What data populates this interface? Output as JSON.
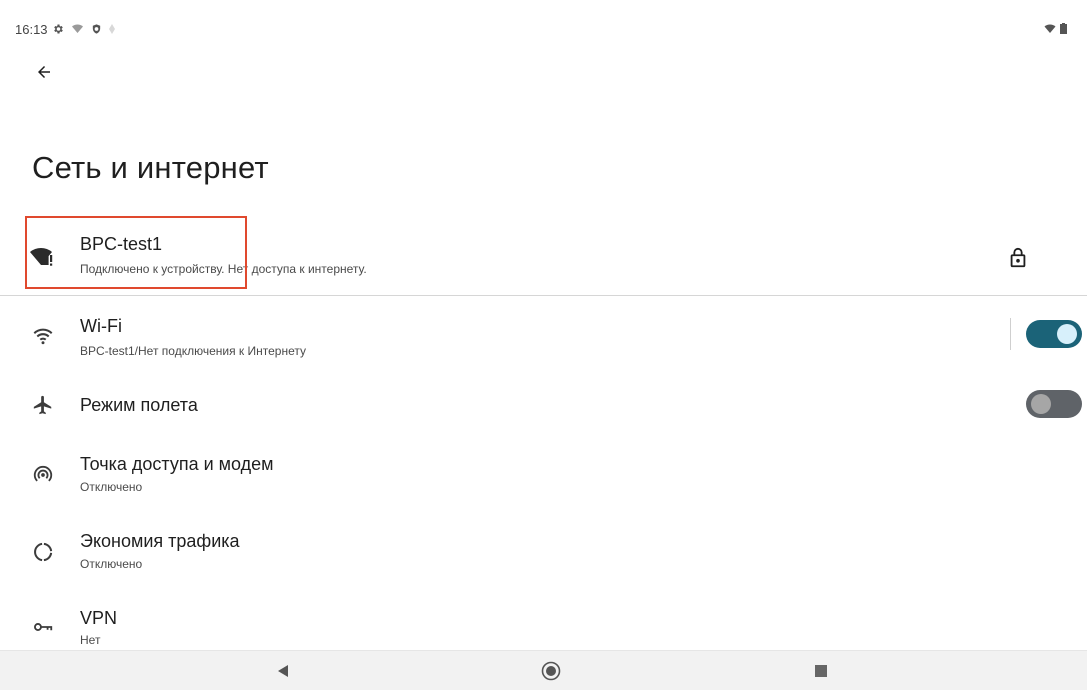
{
  "status_bar": {
    "time": "16:13",
    "icons": [
      "gear-icon",
      "wifi-question-icon",
      "shield-icon",
      "dot-icon"
    ],
    "right_icons": [
      "wifi-alert-icon",
      "battery-icon"
    ]
  },
  "header": {
    "back_icon": "arrow-back-icon",
    "title": "Сеть и интернет"
  },
  "network": {
    "name": "BPC-test1",
    "status": "Подключено к устройству. Нет доступа к интернету.",
    "icon": "wifi-alert-icon",
    "secure_icon": "lock-icon",
    "highlight_color": "#e0492e"
  },
  "settings": [
    {
      "icon": "wifi-icon",
      "title": "Wi-Fi",
      "subtitle": "BPC-test1/Нет подключения к Интернету",
      "toggle": true
    },
    {
      "icon": "airplane-icon",
      "title": "Режим полета",
      "subtitle": "",
      "toggle": false
    },
    {
      "icon": "hotspot-icon",
      "title": "Точка доступа и модем",
      "subtitle": "Отключено"
    },
    {
      "icon": "data-saver-icon",
      "title": "Экономия трафика",
      "subtitle": "Отключено"
    },
    {
      "icon": "vpn-key-icon",
      "title": "VPN",
      "subtitle": "Нет"
    }
  ],
  "nav_bar": {
    "buttons": [
      "back-triangle-icon",
      "home-circle-icon",
      "recents-square-icon"
    ]
  },
  "colors": {
    "toggle_on": "#1b6378",
    "toggle_off": "#5f6368",
    "icon": "#3c3c3c"
  }
}
